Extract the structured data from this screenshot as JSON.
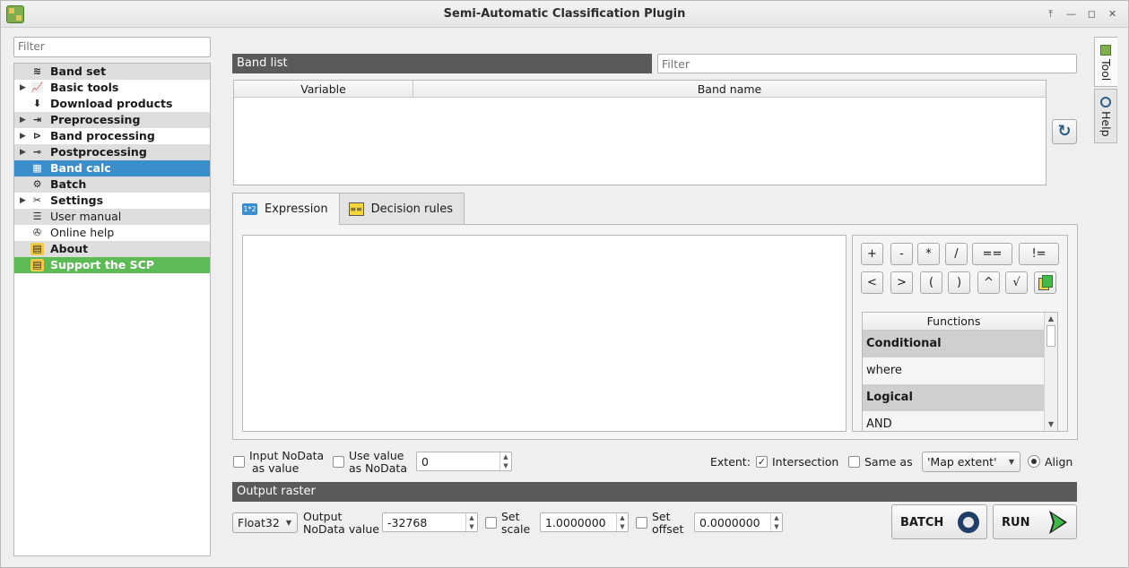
{
  "window": {
    "title": "Semi-Automatic Classification Plugin"
  },
  "sidebar": {
    "filter_placeholder": "Filter",
    "items": [
      {
        "label": "Band set",
        "icon": "band-set-icon"
      },
      {
        "label": "Basic tools",
        "icon": "basic-tools-icon"
      },
      {
        "label": "Download products",
        "icon": "download-icon"
      },
      {
        "label": "Preprocessing",
        "icon": "preprocessing-icon"
      },
      {
        "label": "Band processing",
        "icon": "band-processing-icon"
      },
      {
        "label": "Postprocessing",
        "icon": "postprocessing-icon"
      },
      {
        "label": "Band calc",
        "icon": "band-calc-icon"
      },
      {
        "label": "Batch",
        "icon": "batch-icon"
      },
      {
        "label": "Settings",
        "icon": "settings-icon"
      },
      {
        "label": "User manual",
        "icon": "user-manual-icon"
      },
      {
        "label": "Online help",
        "icon": "online-help-icon"
      },
      {
        "label": "About",
        "icon": "about-icon"
      },
      {
        "label": "Support the SCP",
        "icon": "support-icon"
      }
    ]
  },
  "band_list": {
    "title": "Band list",
    "filter_placeholder": "Filter",
    "columns": [
      "Variable",
      "Band name"
    ]
  },
  "right_tabs": [
    "Tool",
    "Help"
  ],
  "tabs": [
    {
      "label": "Expression",
      "icon_text": "1*2"
    },
    {
      "label": "Decision rules",
      "icon_text": "≡≡"
    }
  ],
  "calc_buttons": {
    "row1": [
      "+",
      "-",
      "*",
      "/",
      "==",
      "!="
    ],
    "row2": [
      "<",
      ">",
      "(",
      ")",
      "^",
      "√"
    ]
  },
  "functions": {
    "header": "Functions",
    "items": [
      {
        "label": "Conditional",
        "group": true
      },
      {
        "label": "where",
        "group": false
      },
      {
        "label": "Logical",
        "group": true
      },
      {
        "label": "AND",
        "group": false
      }
    ]
  },
  "options": {
    "input_nodata_line1": "Input NoData",
    "input_nodata_line2": "as value",
    "use_value_line1": "Use value",
    "use_value_line2": "as NoData",
    "nodata_value": "0",
    "extent_label": "Extent:",
    "intersection_label": "Intersection",
    "same_as_label": "Same as",
    "same_as_value": "'Map extent'",
    "align_label": "Align"
  },
  "output": {
    "title": "Output raster",
    "data_type": "Float32",
    "nodata_line1": "Output",
    "nodata_line2": "NoData value",
    "nodata_value": "-32768",
    "scale_line1": "Set",
    "scale_line2": "scale",
    "scale_value": "1.0000000",
    "offset_line1": "Set",
    "offset_line2": "offset",
    "offset_value": "0.0000000",
    "batch_label": "BATCH",
    "run_label": "RUN"
  }
}
